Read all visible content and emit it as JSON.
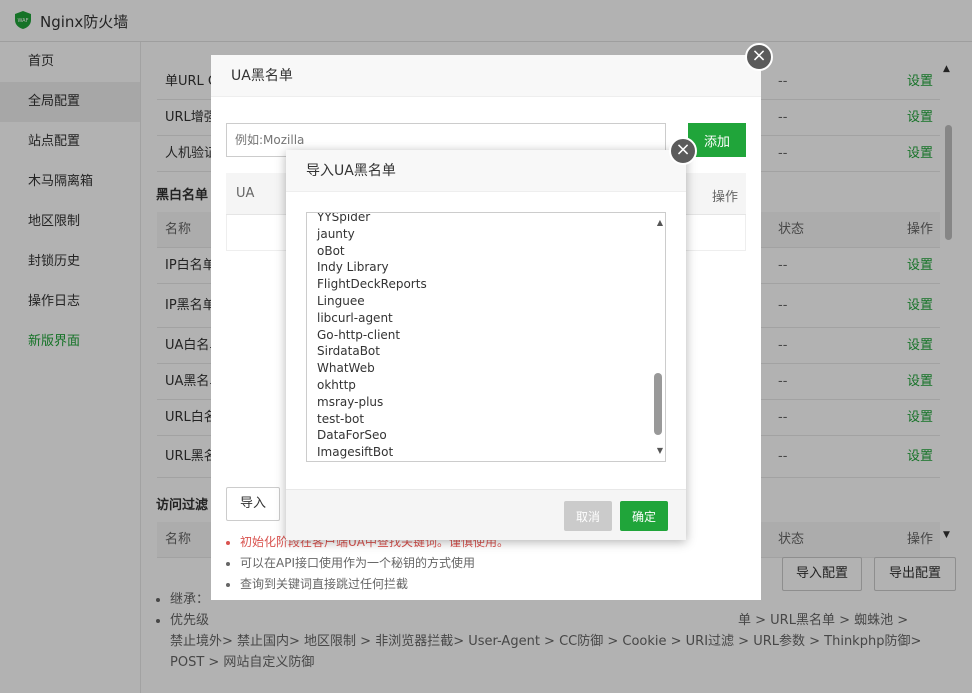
{
  "app": {
    "title": "Nginx防火墙"
  },
  "sidebar": {
    "items": [
      {
        "label": "首页"
      },
      {
        "label": "全局配置"
      },
      {
        "label": "站点配置"
      },
      {
        "label": "木马隔离箱"
      },
      {
        "label": "地区限制"
      },
      {
        "label": "封锁历史"
      },
      {
        "label": "操作日志"
      },
      {
        "label": "新版界面"
      }
    ]
  },
  "main": {
    "top_rows": [
      {
        "name": "单URL C",
        "value": "--",
        "action": "设置"
      },
      {
        "name": "URL增强",
        "value": "--",
        "action": "设置"
      },
      {
        "name": "人机验证",
        "value": "--",
        "action": "设置"
      }
    ],
    "bw_section_title": "黑白名单",
    "bw_header": {
      "name": "名称",
      "status": "状态",
      "action": "操作"
    },
    "bw_rows": [
      {
        "name": "IP白名单",
        "value": "--",
        "action": "设置"
      },
      {
        "name": "IP黑名单",
        "value": "--",
        "action": "设置"
      },
      {
        "name": "UA白名单",
        "value": "--",
        "action": "设置"
      },
      {
        "name": "UA黑名单",
        "value": "--",
        "action": "设置"
      },
      {
        "name": "URL白名",
        "value": "--",
        "action": "设置"
      },
      {
        "name": "URL黑名",
        "value": "--",
        "action": "设置"
      }
    ],
    "filter_section_title": "访问过滤",
    "filter_header": {
      "name": "名称",
      "status": "状态",
      "action": "操作"
    },
    "import_config": "导入配置",
    "export_config": "导出配置",
    "bullet1": "继承：",
    "bullet2a": "优先级",
    "bullet2b": "单 > URL黑名单 > 蜘蛛池 >",
    "bullet2c": "禁止境外> 禁止国内> 地区限制 > 非浏览器拦截> User-Agent > CC防御 > Cookie > URI过滤 > URL参数 > Thinkphp防御>",
    "bullet2d": "POST > 网站自定义防御"
  },
  "modal_ua": {
    "title": "UA黑名单",
    "input_placeholder": "例如:Mozilla",
    "add_label": "添加",
    "col_ua": "UA",
    "col_action": "操作",
    "import_label": "导入",
    "notes": [
      "初始化阶段在客户端UA中查找关键词。谨慎使用。",
      "可以在API接口使用作为一个秘钥的方式使用",
      "查询到关键词直接跳过任何拦截"
    ]
  },
  "modal_import": {
    "title": "导入UA黑名单",
    "lines": [
      "YYSpider",
      "jaunty",
      "oBot",
      "Indy Library",
      "FlightDeckReports",
      "Linguee",
      "libcurl-agent",
      "Go-http-client",
      "SirdataBot",
      "WhatWeb",
      "okhttp",
      "msray-plus",
      "test-bot",
      "DataForSeo",
      "ImagesiftBot"
    ],
    "cancel_label": "取消",
    "ok_label": "确定"
  },
  "icons": {
    "close": "close-icon",
    "logo": "waf-shield-icon"
  },
  "colors": {
    "accent": "#20a53a",
    "danger": "#d9534f"
  }
}
